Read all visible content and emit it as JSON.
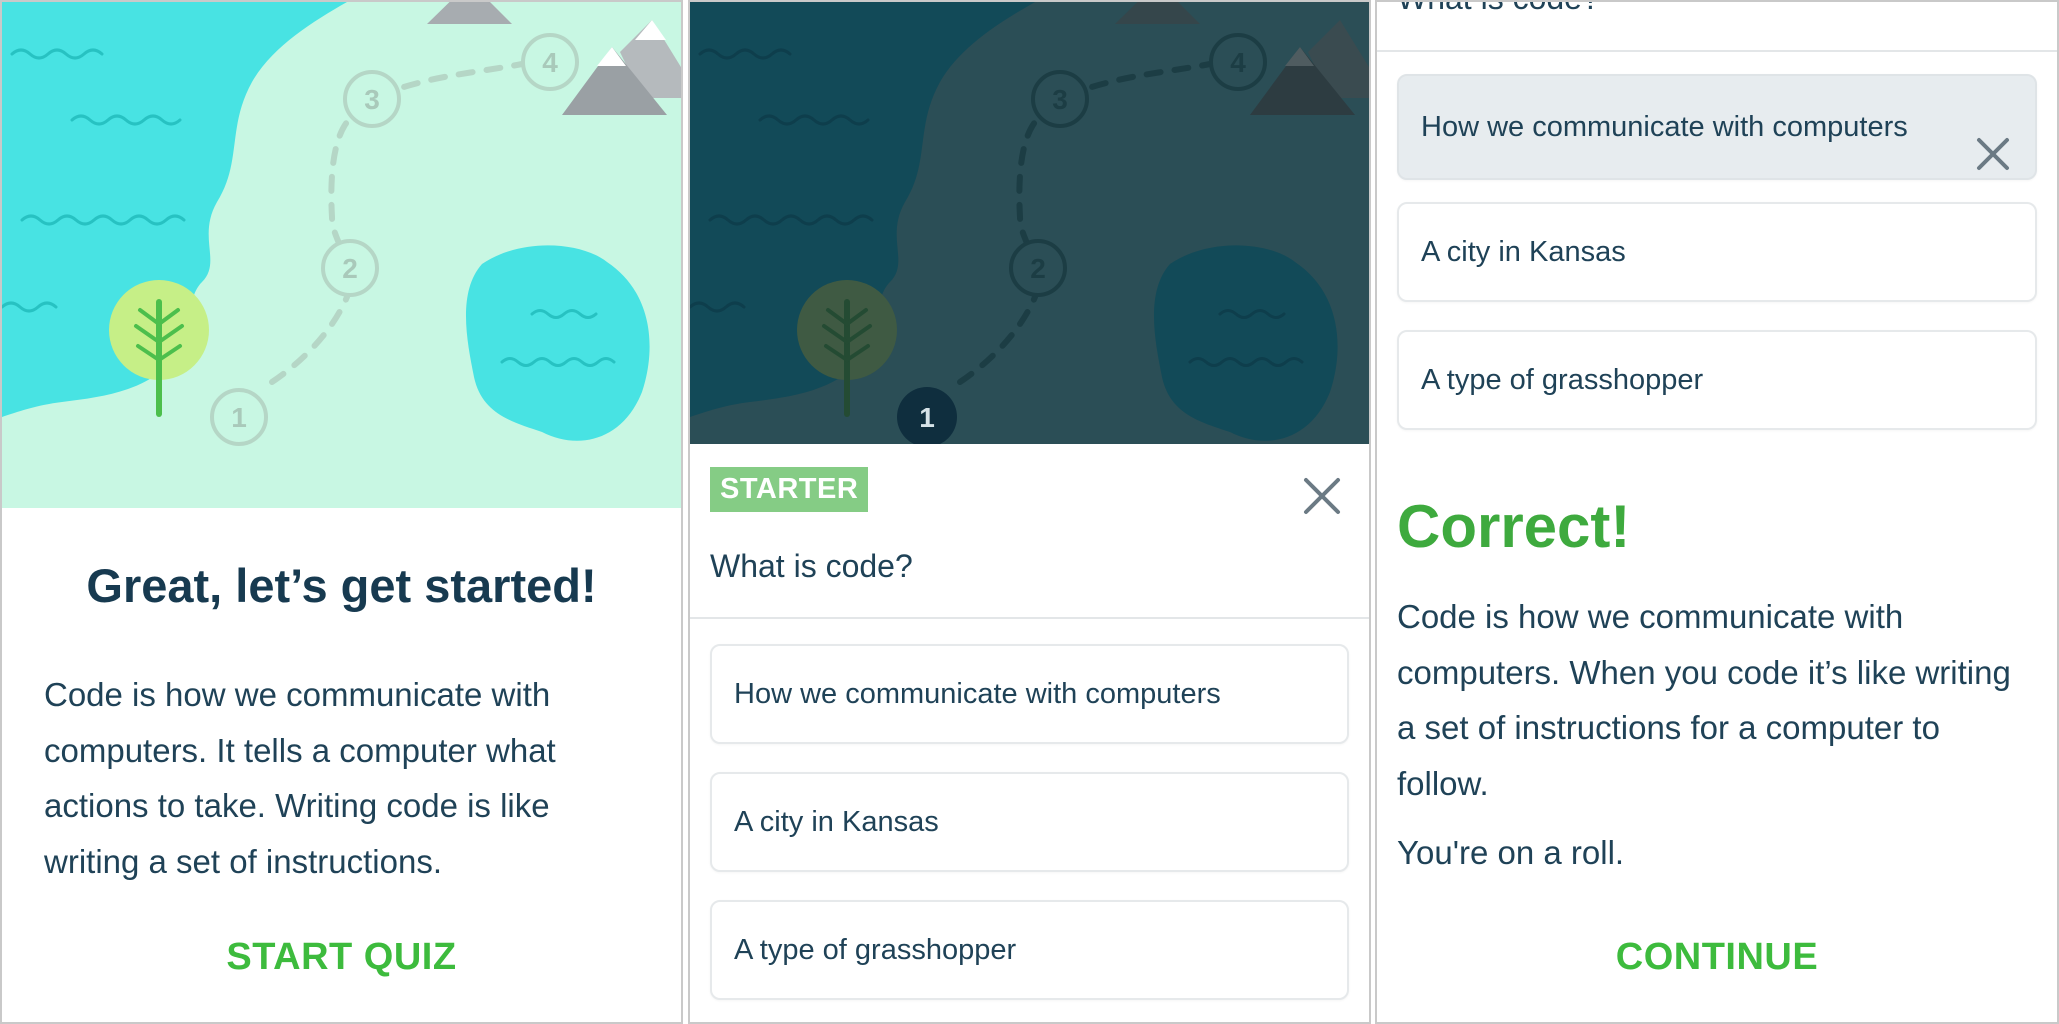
{
  "panel1": {
    "map_steps": [
      "1",
      "2",
      "3",
      "4"
    ],
    "title": "Great, let’s get started!",
    "body": "Code is how we communicate with computers. It tells a computer what actions to take. Writing code is like writing a set of instructions.",
    "action_label": "START QUIZ"
  },
  "panel2": {
    "map_steps": [
      "1",
      "2",
      "3",
      "4"
    ],
    "badge": "STARTER",
    "question": "What is code?",
    "options": [
      "How we communicate with computers",
      "A city in Kansas",
      "A type of grasshopper"
    ]
  },
  "panel3": {
    "question_partial": "What is code?",
    "options": [
      "How we communicate with computers",
      "A city in Kansas",
      "A type of grasshopper"
    ],
    "result_title": "Correct!",
    "explanation": "Code is how we communicate with computers. When you code it’s like writing a set of instructions for a computer to follow.",
    "encouragement": "You're on a roll.",
    "action_label": "CONTINUE"
  },
  "colors": {
    "accent_green": "#3dbb3d",
    "map_land": "#c8f7e3",
    "map_water": "#48e3e3",
    "text_dark": "#173a50"
  },
  "icons": [
    "tree-icon",
    "mountain-icon",
    "close-icon"
  ]
}
